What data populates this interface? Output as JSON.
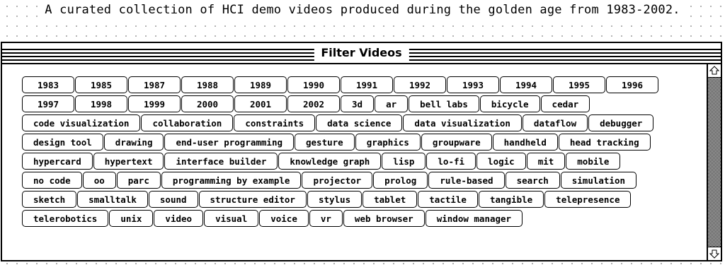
{
  "tagline": "A curated collection of HCI demo videos produced during the golden age from 1983-2002.",
  "window": {
    "title": "Filter Videos"
  },
  "years": [
    "1983",
    "1985",
    "1987",
    "1988",
    "1989",
    "1990",
    "1991",
    "1992",
    "1993",
    "1994",
    "1995",
    "1996",
    "1997",
    "1998",
    "1999",
    "2000",
    "2001",
    "2002"
  ],
  "topics": [
    "3d",
    "ar",
    "bell labs",
    "bicycle",
    "cedar",
    "code visualization",
    "collaboration",
    "constraints",
    "data science",
    "data visualization",
    "dataflow",
    "debugger",
    "design tool",
    "drawing",
    "end-user programming",
    "gesture",
    "graphics",
    "groupware",
    "handheld",
    "head tracking",
    "hypercard",
    "hypertext",
    "interface builder",
    "knowledge graph",
    "lisp",
    "lo-fi",
    "logic",
    "mit",
    "mobile",
    "no code",
    "oo",
    "parc",
    "programming by example",
    "projector",
    "prolog",
    "rule-based",
    "search",
    "simulation",
    "sketch",
    "smalltalk",
    "sound",
    "structure editor",
    "stylus",
    "tablet",
    "tactile",
    "tangible",
    "telepresence",
    "telerobotics",
    "unix",
    "video",
    "visual",
    "voice",
    "vr",
    "web browser",
    "window manager"
  ],
  "scrollbar": {
    "up_icon": "up-arrow-icon",
    "down_icon": "down-arrow-icon"
  }
}
